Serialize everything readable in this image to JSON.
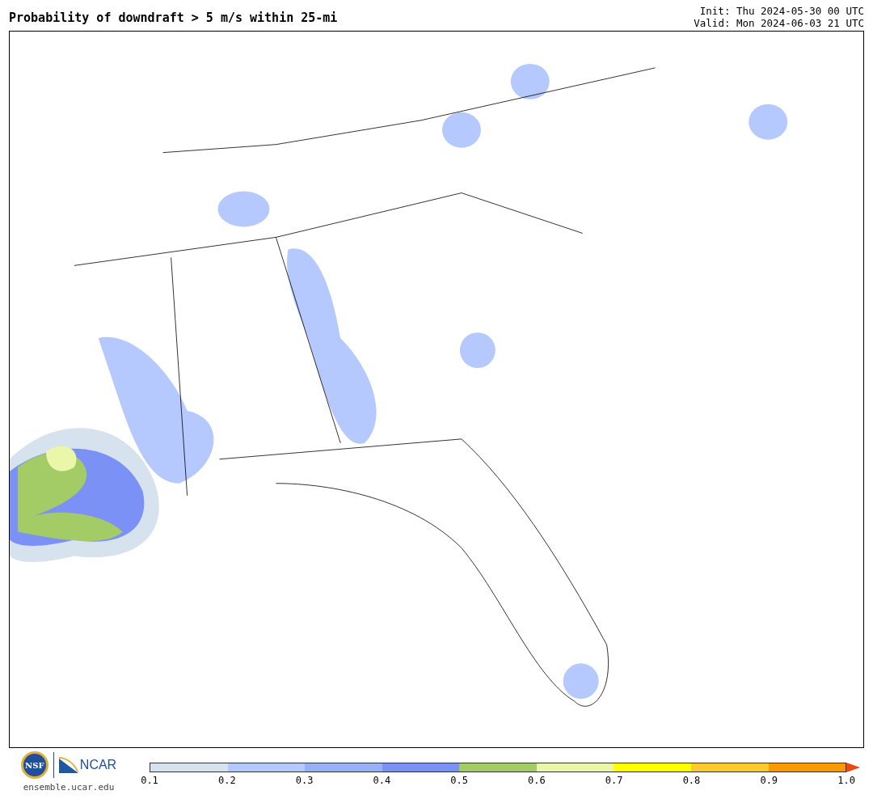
{
  "title": "Probability of downdraft > 5 m/s within 25-mi",
  "init": "Init: Thu 2024-05-30 00 UTC",
  "valid": "Valid: Mon 2024-06-03 21 UTC",
  "logos": {
    "nsf": "NSF",
    "ncar": "NCAR",
    "site": "ensemble.ucar.edu"
  },
  "colorbar": {
    "bins": [
      {
        "color": "#d6e2ee"
      },
      {
        "color": "#b5c9fe"
      },
      {
        "color": "#97b0f8"
      },
      {
        "color": "#7b91f5"
      },
      {
        "color": "#a4cc66"
      },
      {
        "color": "#eaf7a8"
      },
      {
        "color": "#ffff00"
      },
      {
        "color": "#fec92c"
      },
      {
        "color": "#f79a03"
      }
    ],
    "extension": {
      "color": "#e94a0f"
    },
    "ticks": [
      "0.1",
      "0.2",
      "0.3",
      "0.4",
      "0.5",
      "0.6",
      "0.7",
      "0.8",
      "0.9",
      "1.0"
    ]
  }
}
